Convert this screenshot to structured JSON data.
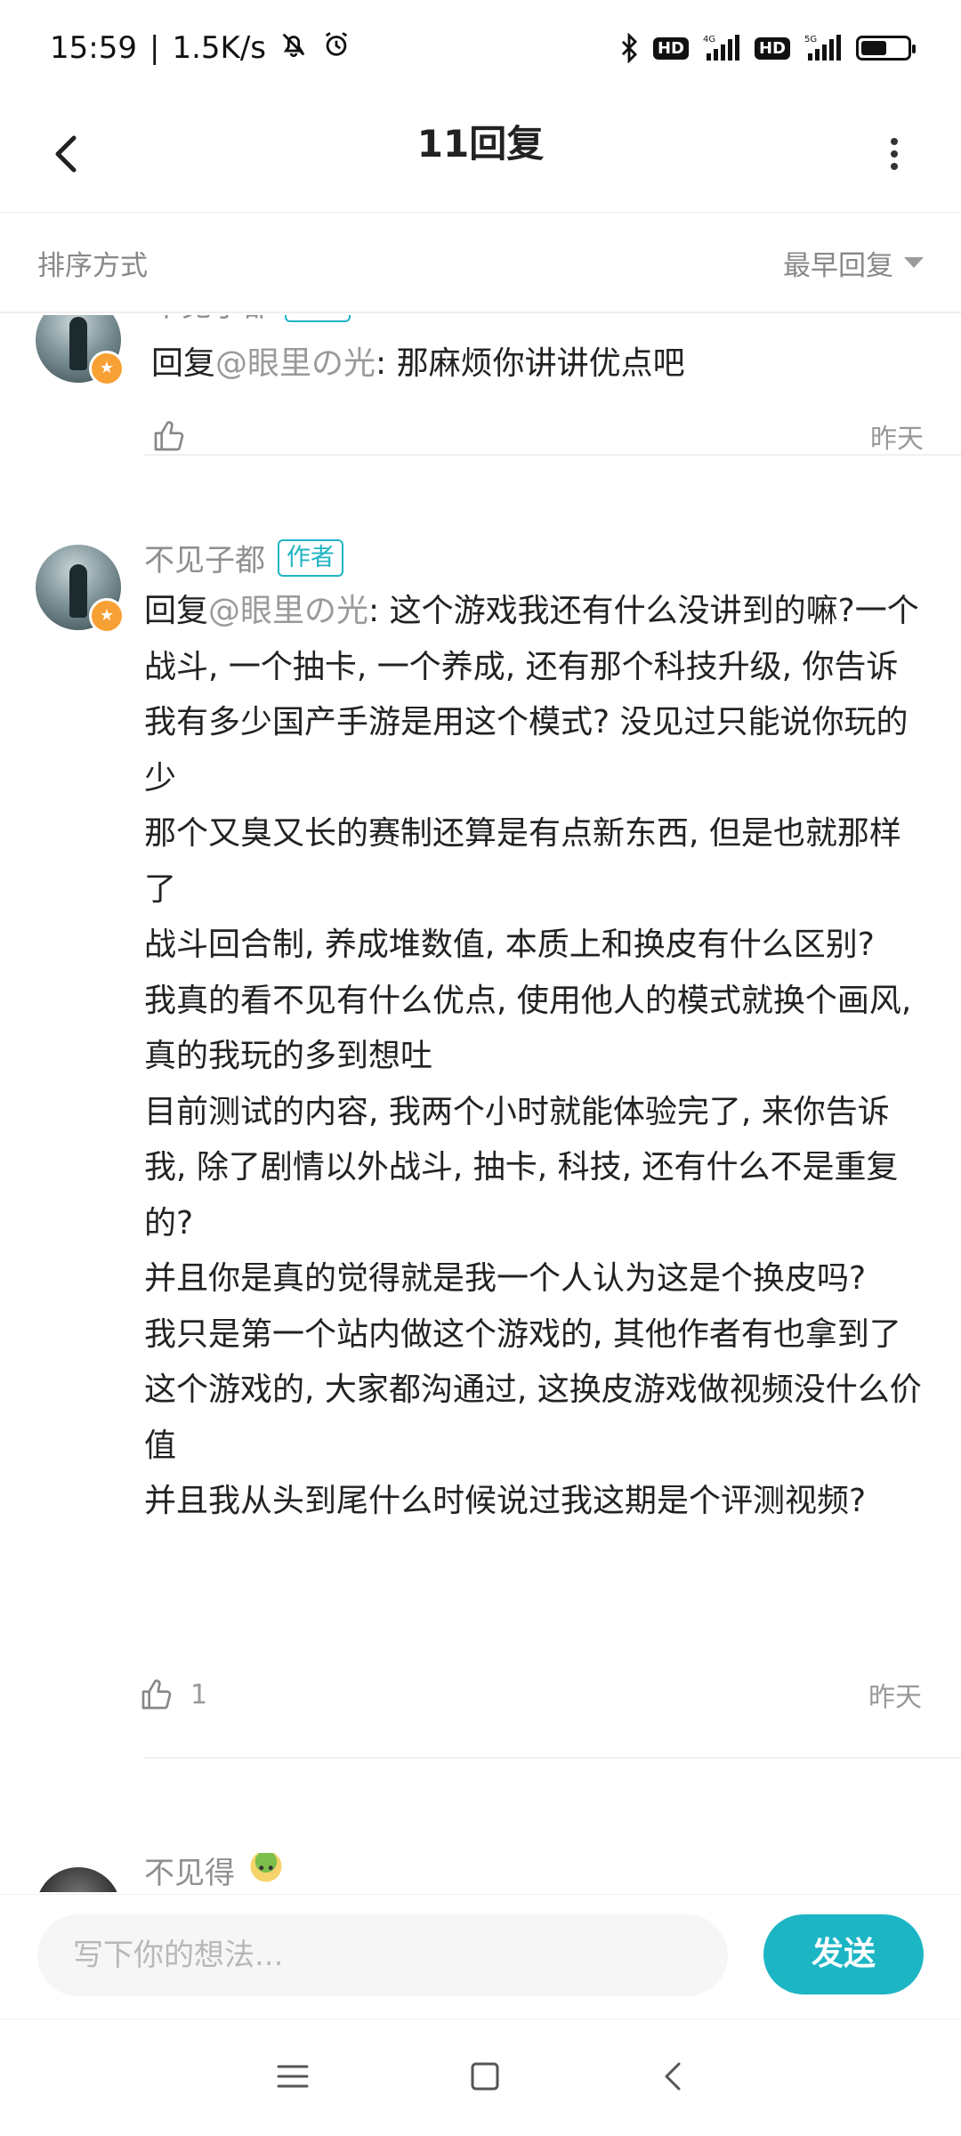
{
  "status_bar": {
    "time": "15:59",
    "speed": "1.5K/s",
    "net1": "4G",
    "net2": "5G",
    "hd_label": "HD",
    "battery_level": 0.55,
    "icons": [
      "mute-bell-icon",
      "alarm-icon",
      "bluetooth-icon",
      "signal-icon",
      "battery-icon"
    ]
  },
  "header": {
    "title": "11回复",
    "back_icon": "chevron-left-icon",
    "more_icon": "more-vertical-icon"
  },
  "sort": {
    "label": "排序方式",
    "selected": "最早回复"
  },
  "comments": [
    {
      "username": "不见子都",
      "badge": "作者",
      "reply_prefix": "回复",
      "mention": "@眼里の光",
      "text": ": 那麻烦你讲讲优点吧",
      "likes": "",
      "time": "昨天"
    },
    {
      "username": "不见子都",
      "badge": "作者",
      "reply_prefix": "回复",
      "mention": "@眼里の光",
      "text": ": 这个游戏我还有什么没讲到的嘛?一个战斗, 一个抽卡, 一个养成, 还有那个科技升级, 你告诉我有多少国产手游是用这个模式? 没见过只能说你玩的少\n那个又臭又长的赛制还算是有点新东西, 但是也就那样了\n战斗回合制, 养成堆数值, 本质上和换皮有什么区别?\n我真的看不见有什么优点, 使用他人的模式就换个画风, 真的我玩的多到想吐\n目前测试的内容, 我两个小时就能体验完了, 来你告诉我, 除了剧情以外战斗, 抽卡, 科技, 还有什么不是重复的?\n并且你是真的觉得就是我一个人认为这是个换皮吗?\n我只是第一个站内做这个游戏的, 其他作者有也拿到了这个游戏的, 大家都沟通过, 这换皮游戏做视频没什么价值\n并且我从头到尾什么时候说过我这期是个评测视频?",
      "likes": "1",
      "time": "昨天"
    },
    {
      "username": "不见得",
      "badge": ""
    }
  ],
  "composer": {
    "placeholder": "写下你的想法...",
    "send_label": "发送"
  },
  "colors": {
    "accent": "#1cb5c4",
    "muted": "#8f8f8f",
    "badge_orange": "#f7a034"
  }
}
